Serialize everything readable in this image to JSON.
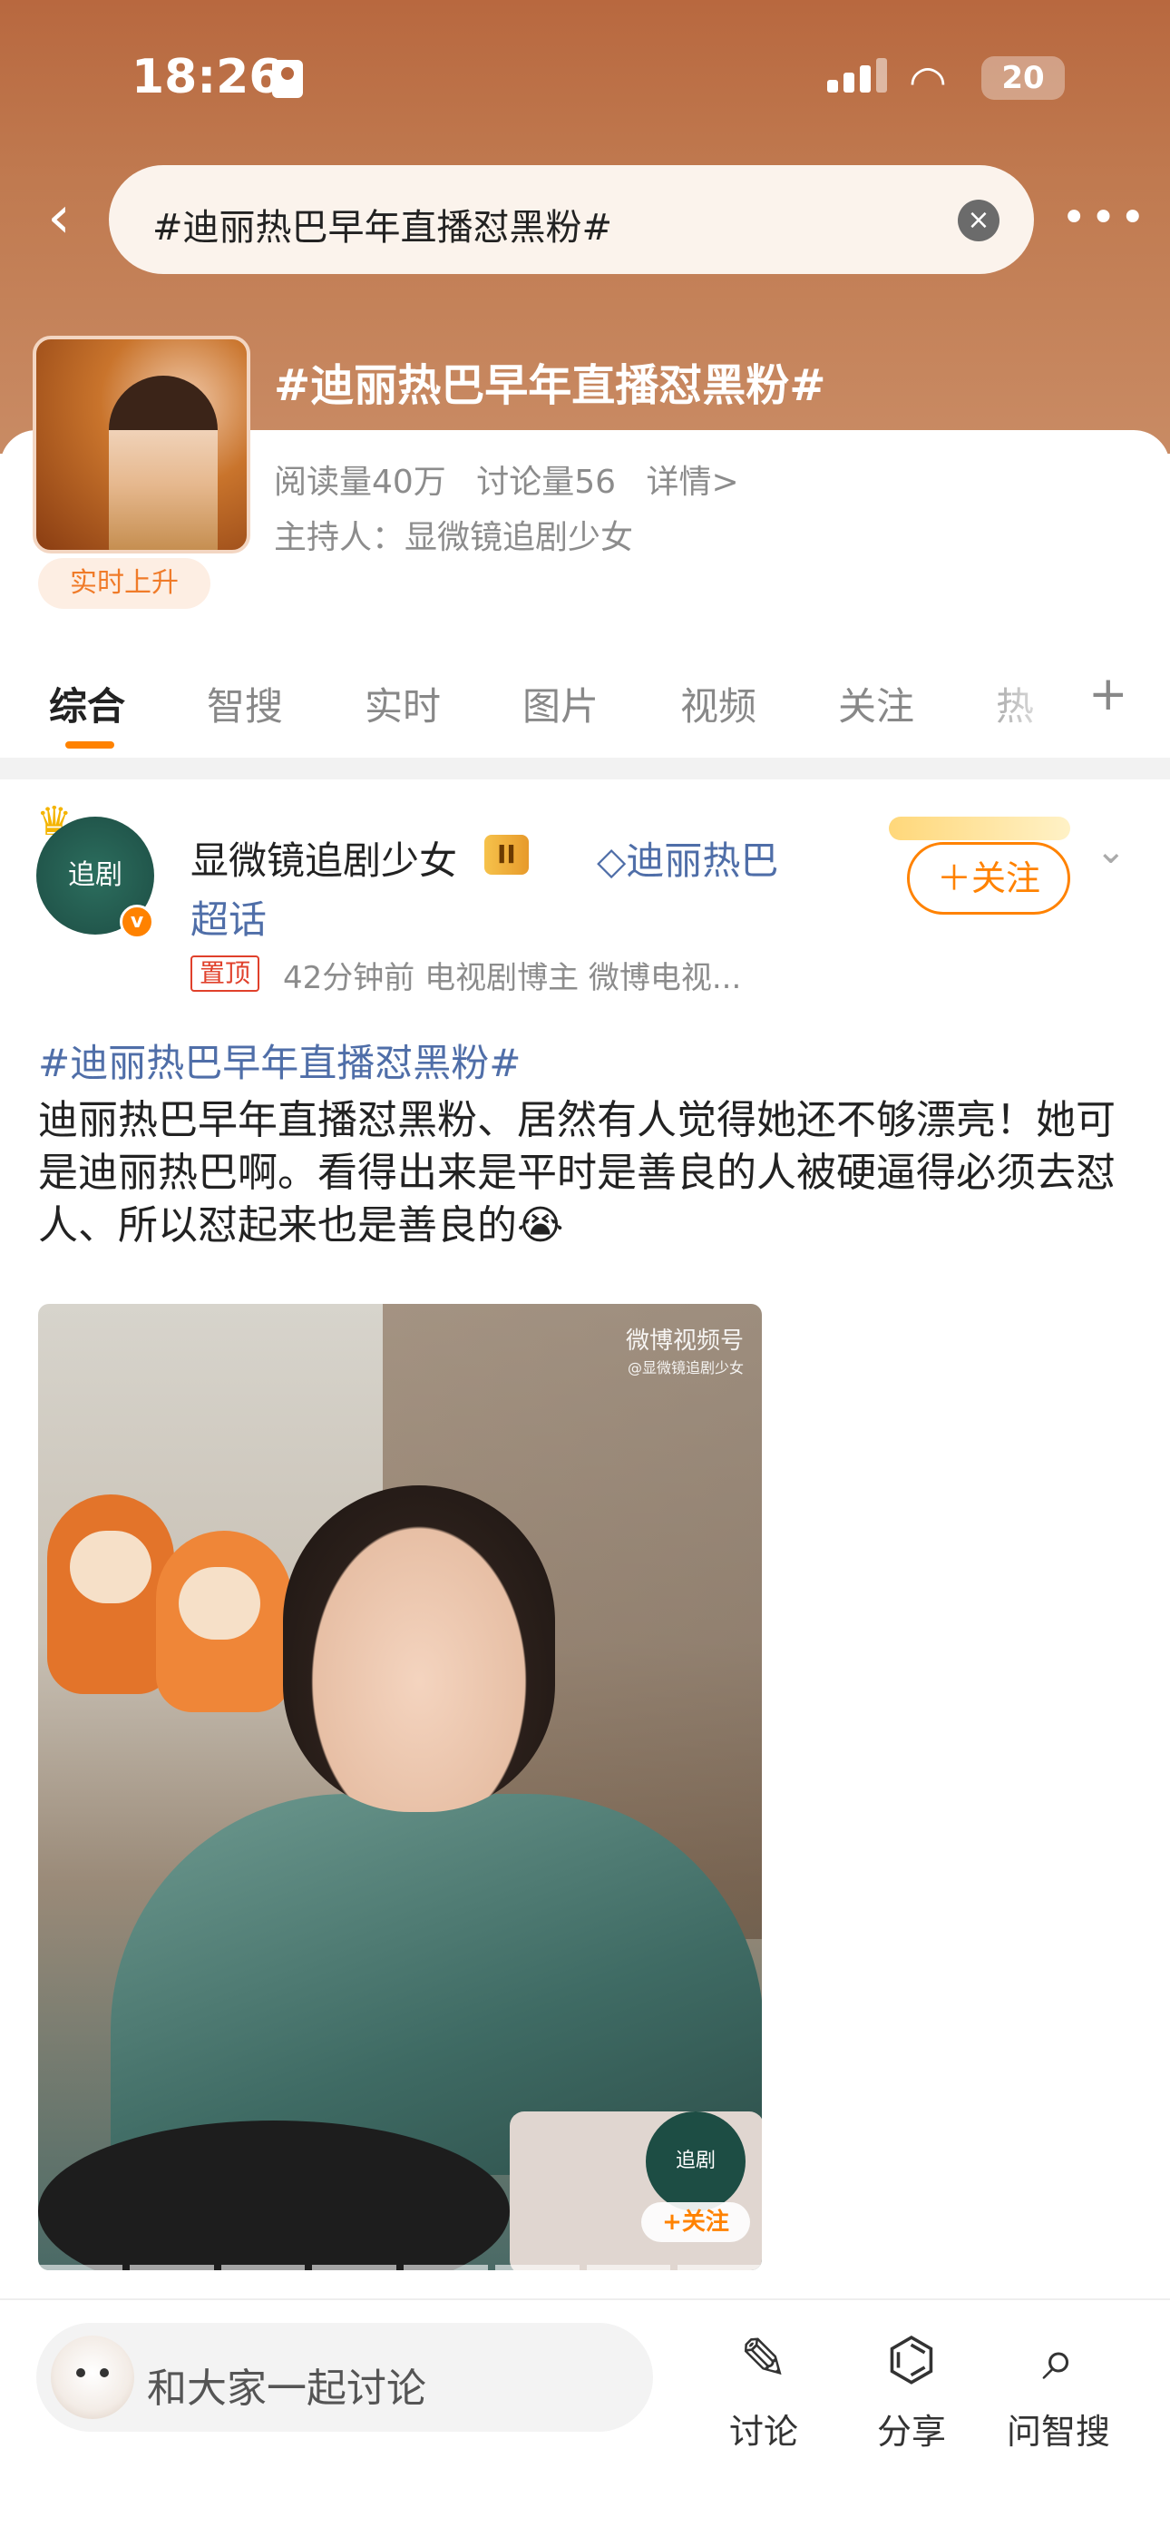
{
  "status_bar": {
    "time": "18:26",
    "battery": "20"
  },
  "search": {
    "query": "#迪丽热巴早年直播怼黑粉#"
  },
  "topic": {
    "title": "#迪丽热巴早年直播怼黑粉#",
    "reads": "阅读量40万",
    "discussions": "讨论量56",
    "details": "详情>",
    "host": "主持人：显微镜追剧少女",
    "rising_badge": "实时上升"
  },
  "tabs": [
    {
      "label": "综合",
      "active": true
    },
    {
      "label": "智搜",
      "active": false
    },
    {
      "label": "实时",
      "active": false
    },
    {
      "label": "图片",
      "active": false
    },
    {
      "label": "视频",
      "active": false
    },
    {
      "label": "关注",
      "active": false
    },
    {
      "label": "热",
      "active": false
    }
  ],
  "post": {
    "author": "显微镜追剧少女",
    "badge": "II",
    "supertopic": "迪丽热巴",
    "supertopic_suffix": "超话",
    "pinned": "置顶",
    "meta": "42分钟前  电视剧博主 微博电视...",
    "follow": "＋关注",
    "topic": "#迪丽热巴早年直播怼黑粉#",
    "body": "迪丽热巴早年直播怼黑粉、居然有人觉得她还不够漂亮！她可是迪丽热巴啊。看得出来是平时是善良的人被硬逼得必须去怼人、所以怼起来也是善良的😭",
    "media": {
      "watermark": "微博视频号",
      "watermark_sub": "@显微镜追剧少女",
      "follow": "+关注"
    }
  },
  "bottom_bar": {
    "comment_placeholder": "和大家一起讨论",
    "actions": [
      {
        "label": "讨论",
        "icon": "edit-icon"
      },
      {
        "label": "分享",
        "icon": "share-icon"
      },
      {
        "label": "问智搜",
        "icon": "ai-search-icon"
      }
    ]
  },
  "colors": {
    "header": "#b8683f",
    "accent": "#ff8200",
    "link": "#4f6ea8"
  }
}
